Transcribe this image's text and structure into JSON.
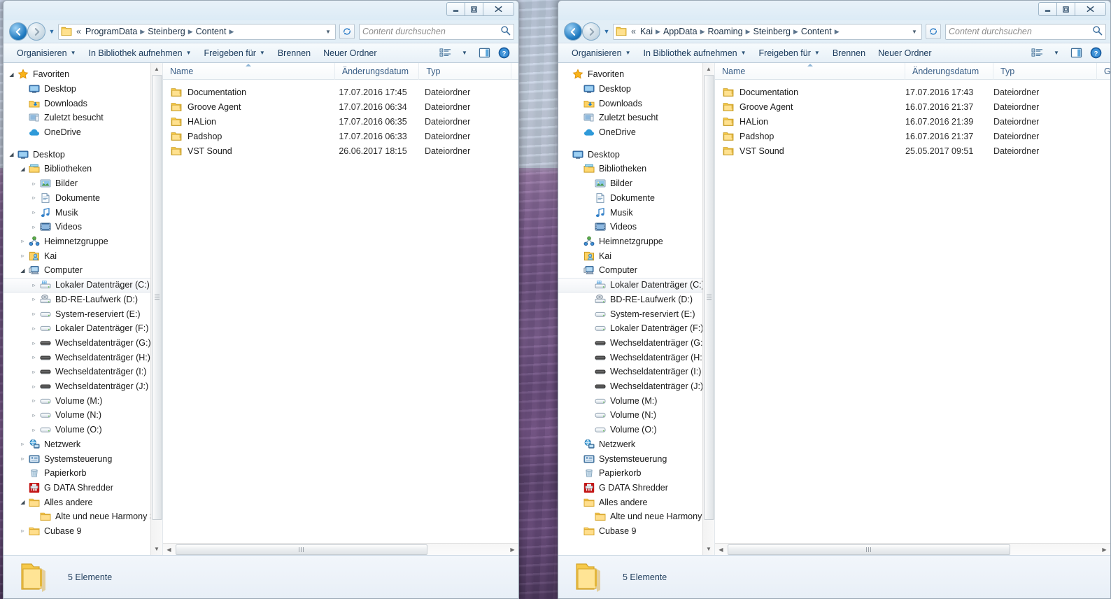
{
  "windows": [
    {
      "id": "left",
      "titlebar": {
        "minimize": "–",
        "maximize": "□",
        "close": "✕"
      },
      "address": {
        "crumbs": [
          "«",
          "ProgramData",
          "Steinberg",
          "Content"
        ],
        "dropdown": "▼",
        "refresh_icon": "refresh-icon"
      },
      "search": {
        "placeholder": "Content durchsuchen"
      },
      "toolbar": {
        "items": [
          {
            "label": "Organisieren",
            "caret": true
          },
          {
            "label": "In Bibliothek aufnehmen",
            "caret": true
          },
          {
            "label": "Freigeben für",
            "caret": true
          },
          {
            "label": "Brennen",
            "caret": false
          },
          {
            "label": "Neuer Ordner",
            "caret": false
          }
        ],
        "view_icon": "view-list-icon",
        "view_caret": "▼",
        "preview_icon": "preview-pane-icon",
        "help_icon": "help-icon"
      },
      "tree": [
        {
          "label": "Favoriten",
          "icon": "star-icon",
          "indent": 0,
          "expander": "open"
        },
        {
          "label": "Desktop",
          "icon": "desktop-icon",
          "indent": 1,
          "expander": "none"
        },
        {
          "label": "Downloads",
          "icon": "downloads-icon",
          "indent": 1,
          "expander": "none"
        },
        {
          "label": "Zuletzt besucht",
          "icon": "recent-icon",
          "indent": 1,
          "expander": "none"
        },
        {
          "label": "OneDrive",
          "icon": "onedrive-icon",
          "indent": 1,
          "expander": "none"
        },
        {
          "label": "",
          "icon": "",
          "indent": 0,
          "expander": "gap"
        },
        {
          "label": "Desktop",
          "icon": "desktop-icon",
          "indent": 0,
          "expander": "open"
        },
        {
          "label": "Bibliotheken",
          "icon": "libraries-icon",
          "indent": 1,
          "expander": "open"
        },
        {
          "label": "Bilder",
          "icon": "pictures-icon",
          "indent": 2,
          "expander": "closed"
        },
        {
          "label": "Dokumente",
          "icon": "documents-icon",
          "indent": 2,
          "expander": "closed"
        },
        {
          "label": "Musik",
          "icon": "music-icon",
          "indent": 2,
          "expander": "closed"
        },
        {
          "label": "Videos",
          "icon": "videos-icon",
          "indent": 2,
          "expander": "closed"
        },
        {
          "label": "Heimnetzgruppe",
          "icon": "homegroup-icon",
          "indent": 1,
          "expander": "closed"
        },
        {
          "label": "Kai",
          "icon": "user-icon",
          "indent": 1,
          "expander": "closed"
        },
        {
          "label": "Computer",
          "icon": "computer-icon",
          "indent": 1,
          "expander": "open"
        },
        {
          "label": "Lokaler Datenträger (C:)",
          "icon": "drive-system-icon",
          "indent": 2,
          "expander": "closed",
          "selected": true
        },
        {
          "label": "BD-RE-Laufwerk (D:)",
          "icon": "optical-drive-icon",
          "indent": 2,
          "expander": "closed"
        },
        {
          "label": "System-reserviert (E:)",
          "icon": "drive-icon",
          "indent": 2,
          "expander": "closed"
        },
        {
          "label": "Lokaler Datenträger (F:)",
          "icon": "drive-icon",
          "indent": 2,
          "expander": "closed"
        },
        {
          "label": "Wechseldatenträger (G:)",
          "icon": "removable-drive-icon",
          "indent": 2,
          "expander": "closed"
        },
        {
          "label": "Wechseldatenträger (H:)",
          "icon": "removable-drive-icon",
          "indent": 2,
          "expander": "closed"
        },
        {
          "label": "Wechseldatenträger (I:)",
          "icon": "removable-drive-icon",
          "indent": 2,
          "expander": "closed"
        },
        {
          "label": "Wechseldatenträger (J:)",
          "icon": "removable-drive-icon",
          "indent": 2,
          "expander": "closed"
        },
        {
          "label": "Volume (M:)",
          "icon": "drive-icon",
          "indent": 2,
          "expander": "closed"
        },
        {
          "label": "Volume (N:)",
          "icon": "drive-icon",
          "indent": 2,
          "expander": "closed"
        },
        {
          "label": "Volume (O:)",
          "icon": "drive-icon",
          "indent": 2,
          "expander": "closed"
        },
        {
          "label": "Netzwerk",
          "icon": "network-icon",
          "indent": 1,
          "expander": "closed"
        },
        {
          "label": "Systemsteuerung",
          "icon": "controlpanel-icon",
          "indent": 1,
          "expander": "closed"
        },
        {
          "label": "Papierkorb",
          "icon": "recyclebin-icon",
          "indent": 1,
          "expander": "none"
        },
        {
          "label": "G DATA Shredder",
          "icon": "shredder-icon",
          "indent": 1,
          "expander": "none"
        },
        {
          "label": "Alles andere",
          "icon": "folder-icon",
          "indent": 1,
          "expander": "open"
        },
        {
          "label": "Alte und neue Harmony Softwa",
          "icon": "folder-icon",
          "indent": 2,
          "expander": "none"
        },
        {
          "label": "Cubase 9",
          "icon": "folder-icon",
          "indent": 1,
          "expander": "closed"
        }
      ],
      "columns": [
        {
          "label": "Name",
          "sorted": true
        },
        {
          "label": "Änderungsdatum",
          "sorted": false
        },
        {
          "label": "Typ",
          "sorted": false
        },
        {
          "label": "",
          "sorted": false
        }
      ],
      "files": [
        {
          "name": "Documentation",
          "date": "17.07.2016 17:45",
          "type": "Dateiordner"
        },
        {
          "name": "Groove Agent",
          "date": "17.07.2016 06:34",
          "type": "Dateiordner"
        },
        {
          "name": "HALion",
          "date": "17.07.2016 06:35",
          "type": "Dateiordner"
        },
        {
          "name": "Padshop",
          "date": "17.07.2016 06:33",
          "type": "Dateiordner"
        },
        {
          "name": "VST Sound",
          "date": "26.06.2017 18:15",
          "type": "Dateiordner"
        }
      ],
      "status": {
        "count": "5 Elemente"
      }
    },
    {
      "id": "right",
      "titlebar": {
        "minimize": "–",
        "maximize": "□",
        "close": "✕"
      },
      "address": {
        "crumbs": [
          "«",
          "Kai",
          "AppData",
          "Roaming",
          "Steinberg",
          "Content"
        ],
        "dropdown": "▼",
        "refresh_icon": "refresh-icon"
      },
      "search": {
        "placeholder": "Content durchsuchen"
      },
      "toolbar": {
        "items": [
          {
            "label": "Organisieren",
            "caret": true
          },
          {
            "label": "In Bibliothek aufnehmen",
            "caret": true
          },
          {
            "label": "Freigeben für",
            "caret": true
          },
          {
            "label": "Brennen",
            "caret": false
          },
          {
            "label": "Neuer Ordner",
            "caret": false
          }
        ],
        "view_icon": "view-list-icon",
        "view_caret": "▼",
        "preview_icon": "preview-pane-icon",
        "help_icon": "help-icon"
      },
      "tree": [
        {
          "label": "Favoriten",
          "icon": "star-icon",
          "indent": 0,
          "expander": "none"
        },
        {
          "label": "Desktop",
          "icon": "desktop-icon",
          "indent": 1,
          "expander": "none"
        },
        {
          "label": "Downloads",
          "icon": "downloads-icon",
          "indent": 1,
          "expander": "none"
        },
        {
          "label": "Zuletzt besucht",
          "icon": "recent-icon",
          "indent": 1,
          "expander": "none"
        },
        {
          "label": "OneDrive",
          "icon": "onedrive-icon",
          "indent": 1,
          "expander": "none"
        },
        {
          "label": "",
          "icon": "",
          "indent": 0,
          "expander": "gap"
        },
        {
          "label": "Desktop",
          "icon": "desktop-icon",
          "indent": 0,
          "expander": "none"
        },
        {
          "label": "Bibliotheken",
          "icon": "libraries-icon",
          "indent": 1,
          "expander": "none"
        },
        {
          "label": "Bilder",
          "icon": "pictures-icon",
          "indent": 2,
          "expander": "none"
        },
        {
          "label": "Dokumente",
          "icon": "documents-icon",
          "indent": 2,
          "expander": "none"
        },
        {
          "label": "Musik",
          "icon": "music-icon",
          "indent": 2,
          "expander": "none"
        },
        {
          "label": "Videos",
          "icon": "videos-icon",
          "indent": 2,
          "expander": "none"
        },
        {
          "label": "Heimnetzgruppe",
          "icon": "homegroup-icon",
          "indent": 1,
          "expander": "none"
        },
        {
          "label": "Kai",
          "icon": "user-icon",
          "indent": 1,
          "expander": "none"
        },
        {
          "label": "Computer",
          "icon": "computer-icon",
          "indent": 1,
          "expander": "none"
        },
        {
          "label": "Lokaler Datenträger (C:)",
          "icon": "drive-system-icon",
          "indent": 2,
          "expander": "none",
          "selected": true
        },
        {
          "label": "BD-RE-Laufwerk (D:)",
          "icon": "optical-drive-icon",
          "indent": 2,
          "expander": "none"
        },
        {
          "label": "System-reserviert (E:)",
          "icon": "drive-icon",
          "indent": 2,
          "expander": "none"
        },
        {
          "label": "Lokaler Datenträger (F:)",
          "icon": "drive-icon",
          "indent": 2,
          "expander": "none"
        },
        {
          "label": "Wechseldatenträger (G:)",
          "icon": "removable-drive-icon",
          "indent": 2,
          "expander": "none"
        },
        {
          "label": "Wechseldatenträger (H:)",
          "icon": "removable-drive-icon",
          "indent": 2,
          "expander": "none"
        },
        {
          "label": "Wechseldatenträger (I:)",
          "icon": "removable-drive-icon",
          "indent": 2,
          "expander": "none"
        },
        {
          "label": "Wechseldatenträger (J:)",
          "icon": "removable-drive-icon",
          "indent": 2,
          "expander": "none"
        },
        {
          "label": "Volume (M:)",
          "icon": "drive-icon",
          "indent": 2,
          "expander": "none"
        },
        {
          "label": "Volume (N:)",
          "icon": "drive-icon",
          "indent": 2,
          "expander": "none"
        },
        {
          "label": "Volume (O:)",
          "icon": "drive-icon",
          "indent": 2,
          "expander": "none"
        },
        {
          "label": "Netzwerk",
          "icon": "network-icon",
          "indent": 1,
          "expander": "none"
        },
        {
          "label": "Systemsteuerung",
          "icon": "controlpanel-icon",
          "indent": 1,
          "expander": "none"
        },
        {
          "label": "Papierkorb",
          "icon": "recyclebin-icon",
          "indent": 1,
          "expander": "none"
        },
        {
          "label": "G DATA Shredder",
          "icon": "shredder-icon",
          "indent": 1,
          "expander": "none"
        },
        {
          "label": "Alles andere",
          "icon": "folder-icon",
          "indent": 1,
          "expander": "none"
        },
        {
          "label": "Alte und neue Harmony Softwa",
          "icon": "folder-icon",
          "indent": 2,
          "expander": "none"
        },
        {
          "label": "Cubase 9",
          "icon": "folder-icon",
          "indent": 1,
          "expander": "none"
        }
      ],
      "columns": [
        {
          "label": "Name",
          "sorted": true
        },
        {
          "label": "Änderungsdatum",
          "sorted": false
        },
        {
          "label": "Typ",
          "sorted": false
        },
        {
          "label": "G",
          "sorted": false
        }
      ],
      "files": [
        {
          "name": "Documentation",
          "date": "17.07.2016 17:43",
          "type": "Dateiordner"
        },
        {
          "name": "Groove Agent",
          "date": "16.07.2016 21:37",
          "type": "Dateiordner"
        },
        {
          "name": "HALion",
          "date": "16.07.2016 21:39",
          "type": "Dateiordner"
        },
        {
          "name": "Padshop",
          "date": "16.07.2016 21:37",
          "type": "Dateiordner"
        },
        {
          "name": "VST Sound",
          "date": "25.05.2017 09:51",
          "type": "Dateiordner"
        }
      ],
      "status": {
        "count": "5 Elemente"
      }
    }
  ],
  "colors": {
    "accent": "#1f7ac0",
    "folder": "#ffd264",
    "header_text": "#3a5f87",
    "wallpaper_lavender": "#7d5f8f"
  }
}
